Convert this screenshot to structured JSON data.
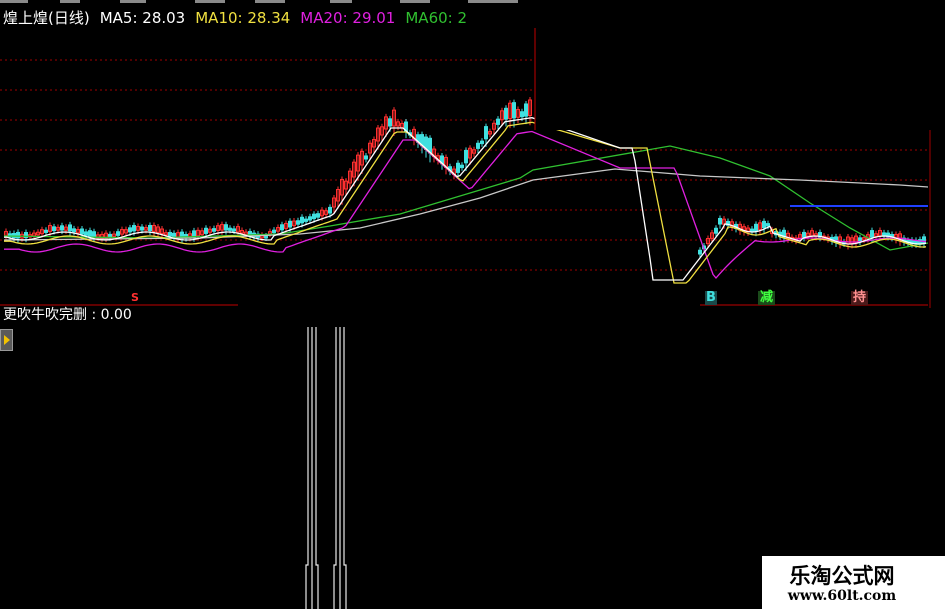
{
  "header": {
    "stock_name": "煌上煌(日线)",
    "ma5": "MA5: 28.03",
    "ma10": "MA10: 28.34",
    "ma20": "MA20: 29.01",
    "ma60": "MA60: 2"
  },
  "colors": {
    "ma5": "#ffffff",
    "ma10": "#f0e040",
    "ma20": "#e020e0",
    "ma60": "#30c030",
    "up": "#ff3030",
    "down": "#40e0e0",
    "grid": "#c00000"
  },
  "markers": {
    "s_mark": "S",
    "b_mark": "B",
    "jian": "减",
    "chi": "持"
  },
  "indicator": {
    "label": "更吹牛吹完删 : 0.00"
  },
  "watermark": {
    "title": "乐淘公式网",
    "url": "www.60lt.com"
  }
}
